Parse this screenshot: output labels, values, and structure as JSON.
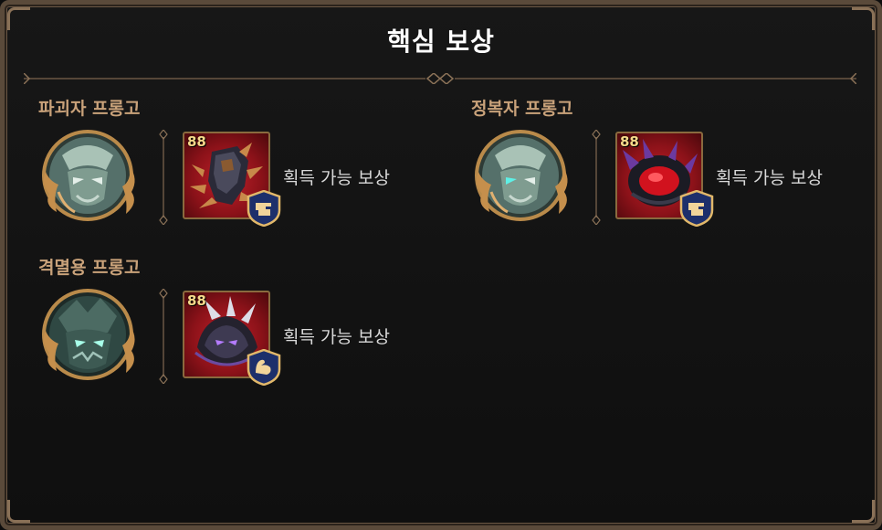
{
  "title": "핵심 보상",
  "sections": [
    {
      "name": "파괴자 프롱고",
      "item_level": "88",
      "reward_text": "획득 가능 보상",
      "item_icon": "clawed-gauntlet-icon",
      "badge_icon": "fist-class-icon"
    },
    {
      "name": "정복자 프롱고",
      "item_level": "88",
      "reward_text": "획득 가능 보상",
      "item_icon": "red-orb-bracer-icon",
      "badge_icon": "fist-class-icon"
    },
    {
      "name": "격멸용 프롱고",
      "item_level": "88",
      "reward_text": "획득 가능 보상",
      "item_icon": "dark-dragon-armor-icon",
      "badge_icon": "muscle-class-icon"
    }
  ],
  "colors": {
    "accent_gold": "#c9a27a",
    "frame_brown": "#5a4a3a",
    "item_red": "#8c1219"
  }
}
